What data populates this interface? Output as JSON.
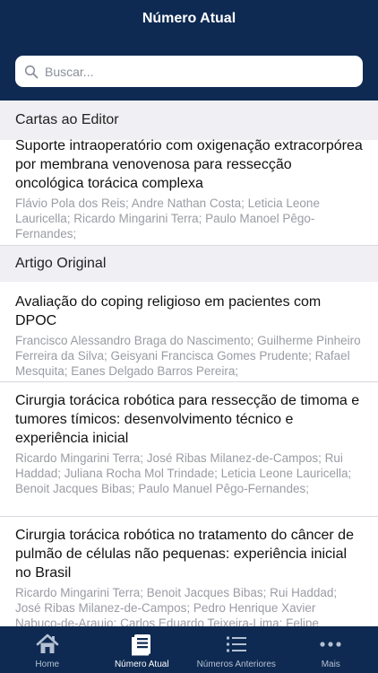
{
  "header": {
    "title": "Número Atual"
  },
  "search": {
    "placeholder": "Buscar..."
  },
  "sections": [
    {
      "title": "Cartas ao Editor",
      "articles": [
        {
          "title": "Suporte intraoperatório com oxigenação extracorpórea por membrana venovenosa para ressecção oncológica torácica complexa",
          "authors": "Flávio Pola dos Reis; Andre Nathan Costa; Leticia Leone Lauricella; Ricardo Mingarini Terra; Paulo Manoel Pêgo-Fernandes;"
        }
      ]
    },
    {
      "title": "Artigo Original",
      "articles": [
        {
          "title": "Avaliação do coping religioso em pacientes com DPOC",
          "authors": "Francisco Alessandro Braga do Nascimento; Guilherme Pinheiro Ferreira da Silva; Geisyani Francisca Gomes Prudente; Rafael Mesquita; Eanes Delgado Barros Pereira;"
        },
        {
          "title": "Cirurgia torácica robótica para ressecção de timoma e tumores tímicos: desenvolvimento técnico e experiência inicial",
          "authors": "Ricardo Mingarini Terra; José Ribas Milanez-de-Campos; Rui Haddad; Juliana Rocha Mol Trindade; Leticia Leone Lauricella; Benoit Jacques Bibas; Paulo Manuel Pêgo-Fernandes;"
        },
        {
          "title": "Cirurgia torácica robótica no tratamento do câncer de pulmão de células não pequenas: experiência inicial no Brasil",
          "authors": "Ricardo Mingarini Terra; Benoit Jacques Bibas; Rui Haddad; José Ribas Milanez-de-Campos; Pedro Henrique Xavier Nabuco-de-Araujo; Carlos Eduardo Teixeira-Lima; Felipe"
        }
      ]
    }
  ],
  "tabs": [
    {
      "label": "Home",
      "icon": "home-icon",
      "active": false
    },
    {
      "label": "Número Atual",
      "icon": "journal-icon",
      "active": true
    },
    {
      "label": "Números Anteriores",
      "icon": "list-icon",
      "active": false
    },
    {
      "label": "Mais",
      "icon": "more-icon",
      "active": false
    }
  ],
  "colors": {
    "brand": "#0e2a52",
    "section_bg": "#efeff4",
    "author_text": "#9a9ca3"
  }
}
